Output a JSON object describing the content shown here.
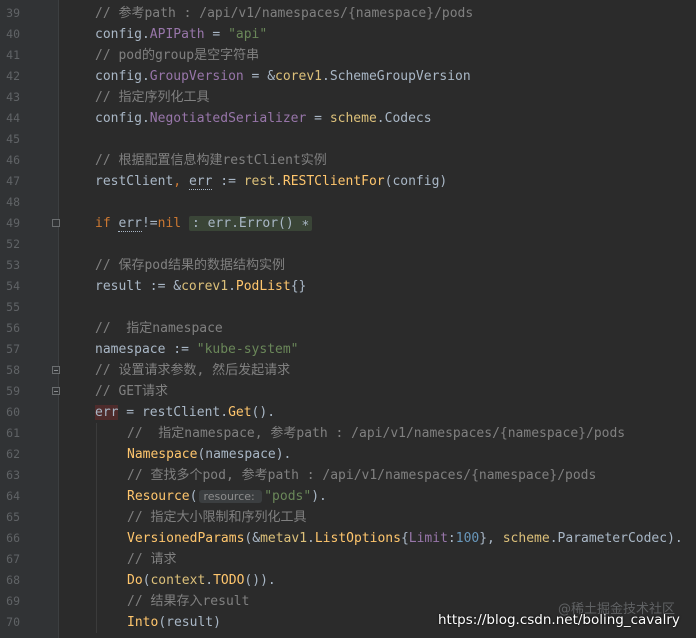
{
  "editor": {
    "lines": [
      {
        "n": "39",
        "parts": [
          {
            "c": "c",
            "t": "// 参考path : /api/v1/namespaces/{namespace}/pods"
          }
        ]
      },
      {
        "n": "40",
        "parts": [
          {
            "c": "t",
            "t": "config."
          },
          {
            "c": "p",
            "t": "APIPath"
          },
          {
            "c": "t",
            "t": " = "
          },
          {
            "c": "s",
            "t": "\"api\""
          }
        ]
      },
      {
        "n": "41",
        "parts": [
          {
            "c": "c",
            "t": "// pod的group是空字符串"
          }
        ]
      },
      {
        "n": "42",
        "parts": [
          {
            "c": "t",
            "t": "config."
          },
          {
            "c": "p",
            "t": "GroupVersion"
          },
          {
            "c": "t",
            "t": " = &"
          },
          {
            "c": "sch",
            "t": "corev1"
          },
          {
            "c": "t",
            "t": ".SchemeGroupVersion"
          }
        ]
      },
      {
        "n": "43",
        "parts": [
          {
            "c": "c",
            "t": "// 指定序列化工具"
          }
        ]
      },
      {
        "n": "44",
        "parts": [
          {
            "c": "t",
            "t": "config."
          },
          {
            "c": "p",
            "t": "NegotiatedSerializer"
          },
          {
            "c": "t",
            "t": " = "
          },
          {
            "c": "sch",
            "t": "scheme"
          },
          {
            "c": "t",
            "t": ".Codecs"
          }
        ]
      },
      {
        "n": "45",
        "parts": []
      },
      {
        "n": "46",
        "parts": [
          {
            "c": "c",
            "t": "// 根据配置信息构建restClient实例"
          }
        ]
      },
      {
        "n": "47",
        "parts": [
          {
            "c": "t",
            "t": "restClient"
          },
          {
            "c": "k",
            "t": ", "
          },
          {
            "c": "t errbox",
            "t": "err"
          },
          {
            "c": "t",
            "t": " := "
          },
          {
            "c": "sch",
            "t": "rest"
          },
          {
            "c": "t",
            "t": "."
          },
          {
            "c": "f",
            "t": "RESTClientFor"
          },
          {
            "c": "t",
            "t": "(config)"
          }
        ]
      },
      {
        "n": "48",
        "parts": []
      },
      {
        "n": "49",
        "fold": "plus",
        "parts": [
          {
            "c": "k",
            "t": "if "
          },
          {
            "c": "t errbox",
            "t": "err"
          },
          {
            "c": "t",
            "t": "!="
          },
          {
            "c": "k",
            "t": "nil"
          },
          {
            "c": "t",
            "t": " "
          },
          {
            "c": "foldblock",
            "t": ": err.Error() ∗"
          }
        ]
      },
      {
        "n": "52",
        "parts": []
      },
      {
        "n": "53",
        "parts": [
          {
            "c": "c",
            "t": "// 保存pod结果的数据结构实例"
          }
        ]
      },
      {
        "n": "54",
        "parts": [
          {
            "c": "t",
            "t": "result := &"
          },
          {
            "c": "sch",
            "t": "corev1"
          },
          {
            "c": "t",
            "t": "."
          },
          {
            "c": "f",
            "t": "PodList"
          },
          {
            "c": "t",
            "t": "{}"
          }
        ]
      },
      {
        "n": "55",
        "parts": []
      },
      {
        "n": "56",
        "parts": [
          {
            "c": "c",
            "t": "//  指定namespace"
          }
        ]
      },
      {
        "n": "57",
        "parts": [
          {
            "c": "t",
            "t": "namespace := "
          },
          {
            "c": "s",
            "t": "\"kube-system\""
          }
        ]
      },
      {
        "n": "58",
        "fold": "minus",
        "parts": [
          {
            "c": "c",
            "t": "// 设置请求参数, 然后发起请求"
          }
        ]
      },
      {
        "n": "59",
        "fold": "minus",
        "parts": [
          {
            "c": "c",
            "t": "// GET请求"
          }
        ]
      },
      {
        "n": "60",
        "parts": [
          {
            "c": "t errred",
            "t": "err"
          },
          {
            "c": "t",
            "t": " = restClient."
          },
          {
            "c": "f",
            "t": "Get"
          },
          {
            "c": "t",
            "t": "()."
          }
        ]
      },
      {
        "n": "61",
        "indent": true,
        "parts": [
          {
            "c": "c",
            "t": "//  指定namespace, 参考path : /api/v1/namespaces/{namespace}/pods"
          }
        ]
      },
      {
        "n": "62",
        "indent": true,
        "parts": [
          {
            "c": "f",
            "t": "Namespace"
          },
          {
            "c": "t",
            "t": "(namespace)."
          }
        ]
      },
      {
        "n": "63",
        "indent": true,
        "parts": [
          {
            "c": "c",
            "t": "// 查找多个pod, 参考path : /api/v1/namespaces/{namespace}/pods"
          }
        ]
      },
      {
        "n": "64",
        "indent": true,
        "parts": [
          {
            "c": "f",
            "t": "Resource"
          },
          {
            "c": "t",
            "t": "("
          },
          {
            "c": "hint",
            "t": "resource: "
          },
          {
            "c": "s",
            "t": "\"pods\""
          },
          {
            "c": "t",
            "t": ")."
          }
        ]
      },
      {
        "n": "65",
        "indent": true,
        "parts": [
          {
            "c": "c",
            "t": "// 指定大小限制和序列化工具"
          }
        ]
      },
      {
        "n": "66",
        "indent": true,
        "parts": [
          {
            "c": "f",
            "t": "VersionedParams"
          },
          {
            "c": "t",
            "t": "(&"
          },
          {
            "c": "sch",
            "t": "metav1"
          },
          {
            "c": "t",
            "t": "."
          },
          {
            "c": "f",
            "t": "ListOptions"
          },
          {
            "c": "t",
            "t": "{"
          },
          {
            "c": "p",
            "t": "Limit"
          },
          {
            "c": "t",
            "t": ":"
          },
          {
            "c": "n",
            "t": "100"
          },
          {
            "c": "t",
            "t": "}, "
          },
          {
            "c": "sch",
            "t": "scheme"
          },
          {
            "c": "t",
            "t": ".ParameterCodec)."
          }
        ]
      },
      {
        "n": "67",
        "indent": true,
        "parts": [
          {
            "c": "c",
            "t": "// 请求"
          }
        ]
      },
      {
        "n": "68",
        "indent": true,
        "parts": [
          {
            "c": "f",
            "t": "Do"
          },
          {
            "c": "t",
            "t": "("
          },
          {
            "c": "sch",
            "t": "context"
          },
          {
            "c": "t",
            "t": "."
          },
          {
            "c": "f",
            "t": "TODO"
          },
          {
            "c": "t",
            "t": "())."
          }
        ]
      },
      {
        "n": "69",
        "indent": true,
        "parts": [
          {
            "c": "c",
            "t": "// 结果存入result"
          }
        ]
      },
      {
        "n": "70",
        "indent": true,
        "parts": [
          {
            "c": "f",
            "t": "Into"
          },
          {
            "c": "t",
            "t": "(result)"
          }
        ]
      }
    ]
  },
  "watermark": {
    "top": "@稀土掘金技术社区",
    "bottom": "https://blog.csdn.net/boling_cavalry"
  }
}
